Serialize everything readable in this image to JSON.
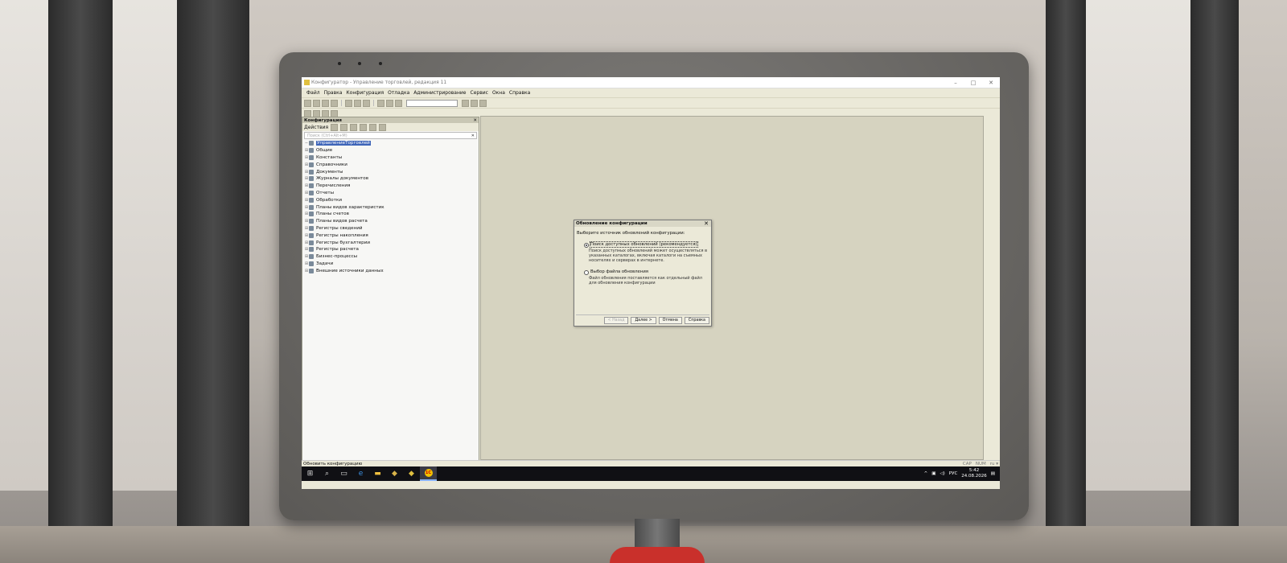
{
  "window": {
    "title": "Конфигуратор - Управление торговлей, редакция 11"
  },
  "menu": [
    "Файл",
    "Правка",
    "Конфигурация",
    "Отладка",
    "Администрирование",
    "Сервис",
    "Окна",
    "Справка"
  ],
  "config_panel": {
    "header": "Конфигурация",
    "actions_label": "Действия",
    "search_placeholder": "Поиск (Ctrl+Alt+M)",
    "tree": [
      {
        "label": "УправлениеТорговлей",
        "root": true
      },
      {
        "label": "Общие"
      },
      {
        "label": "Константы"
      },
      {
        "label": "Справочники"
      },
      {
        "label": "Документы"
      },
      {
        "label": "Журналы документов"
      },
      {
        "label": "Перечисления"
      },
      {
        "label": "Отчеты"
      },
      {
        "label": "Обработки"
      },
      {
        "label": "Планы видов характеристик"
      },
      {
        "label": "Планы счетов"
      },
      {
        "label": "Планы видов расчета"
      },
      {
        "label": "Регистры сведений"
      },
      {
        "label": "Регистры накопления"
      },
      {
        "label": "Регистры бухгалтерии"
      },
      {
        "label": "Регистры расчета"
      },
      {
        "label": "Бизнес-процессы"
      },
      {
        "label": "Задачи"
      },
      {
        "label": "Внешние источники данных"
      }
    ]
  },
  "dialog": {
    "title": "Обновление конфигурации",
    "prompt": "Выберите источник обновлений конфигурации:",
    "option1": {
      "label": "Поиск доступных обновлений (рекомендуется)",
      "description": "Поиск доступных обновлений может осуществляться в указанных каталогах, включая каталоги на съемных носителях и серверах в интернете.",
      "selected": true
    },
    "option2": {
      "label": "Выбор файла обновления",
      "description": "Файл обновления поставляется как отдельный файл для обновления конфигурации",
      "selected": false
    },
    "buttons": {
      "back": "< Назад",
      "next": "Далее >",
      "cancel": "Отмена",
      "help": "Справка"
    }
  },
  "statusbar": {
    "text": "Обновить конфигурацию",
    "cap": "CAP",
    "num": "NUM",
    "ovr": "ru ▾"
  },
  "taskbar": {
    "active_app_label": "1С",
    "lang": "РУС",
    "time": "5:42",
    "date": "24.08.2026"
  }
}
